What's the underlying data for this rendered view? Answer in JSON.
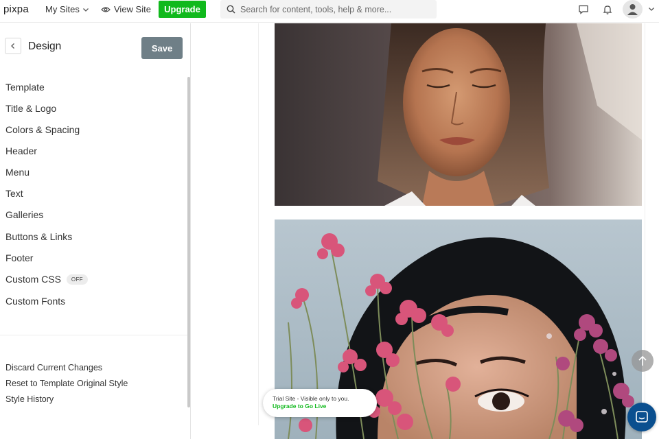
{
  "topbar": {
    "logo": "pixpa",
    "my_sites": "My Sites",
    "view_site": "View Site",
    "upgrade": "Upgrade",
    "search_placeholder": "Search for content, tools, help & more..."
  },
  "sidebar": {
    "title": "Design",
    "save": "Save",
    "items": [
      {
        "label": "Template"
      },
      {
        "label": "Title & Logo"
      },
      {
        "label": "Colors & Spacing"
      },
      {
        "label": "Header"
      },
      {
        "label": "Menu"
      },
      {
        "label": "Text"
      },
      {
        "label": "Galleries"
      },
      {
        "label": "Buttons & Links"
      },
      {
        "label": "Footer"
      },
      {
        "label": "Custom CSS",
        "badge": "OFF"
      },
      {
        "label": "Custom Fonts"
      }
    ],
    "bottom_links": [
      {
        "label": "Discard Current Changes"
      },
      {
        "label": "Reset to Template Original Style"
      },
      {
        "label": "Style History"
      }
    ]
  },
  "preview": {
    "trial_text": "Trial Site - Visible only to you.",
    "trial_link": "Upgrade to Go Live"
  },
  "colors": {
    "upgrade_green": "#10b91c",
    "save_gray": "#6f7f87",
    "chat_blue": "#0a4f8f"
  },
  "icons": [
    "chevron-down-icon",
    "eye-icon",
    "search-icon",
    "chat-icon",
    "bell-icon",
    "user-icon",
    "chevron-left-icon",
    "arrow-up-icon",
    "messenger-icon"
  ]
}
